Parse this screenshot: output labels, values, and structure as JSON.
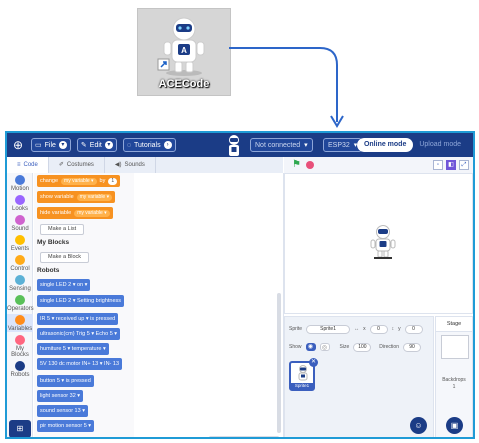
{
  "desktop": {
    "shortcut_label": "ACECode",
    "shortcut_icon": "acecode-robot-icon"
  },
  "menubar": {
    "file_label": "File",
    "edit_label": "Edit",
    "tutorials_label": "Tutorials",
    "connection_status": "Not connected",
    "board": "ESP32",
    "online_mode": "Online mode",
    "upload_mode": "Upload mode"
  },
  "tabs": {
    "code": "Code",
    "costumes": "Costumes",
    "sounds": "Sounds"
  },
  "categories": [
    {
      "label": "Motion",
      "color": "#4a7ad9"
    },
    {
      "label": "Looks",
      "color": "#9966ff"
    },
    {
      "label": "Sound",
      "color": "#cf63cf"
    },
    {
      "label": "Events",
      "color": "#ffbf00"
    },
    {
      "label": "Control",
      "color": "#ffab19"
    },
    {
      "label": "Sensing",
      "color": "#5cb1d6"
    },
    {
      "label": "Operators",
      "color": "#59c059"
    },
    {
      "label": "Variables",
      "color": "#ff8c1a"
    },
    {
      "label": "My Blocks",
      "color": "#ff6680"
    },
    {
      "label": "Robots",
      "color": "#1b3c86"
    }
  ],
  "palette": {
    "change_block": {
      "text": "change",
      "var": "my variable ▾",
      "by": "by",
      "value": "1"
    },
    "show_block": {
      "text": "show variable",
      "var": "my variable ▾"
    },
    "hide_block": {
      "text": "hide variable",
      "var": "my variable ▾"
    },
    "make_list": "Make a List",
    "my_blocks_title": "My Blocks",
    "make_block": "Make a Block",
    "robots_title": "Robots",
    "robot_blocks": [
      "single LED   2 ▾   on ▾",
      "single LED   2 ▾   Setting brightness",
      "IR   5 ▾   received   up ▾   is pressed",
      "ultrasonic(cm) Trig   5 ▾   Echo   5 ▾",
      "humiture   5 ▾   temperature ▾",
      "5V 130 dc motor IN+   13 ▾   IN-   13",
      "button   5 ▾   is pressed",
      "light sensor   32 ▾",
      "sound sensor   13 ▾",
      "pir motion sensor   5 ▾"
    ]
  },
  "script": {
    "zoom_in": "+",
    "zoom_out": "−",
    "zoom_reset": "="
  },
  "sprite_info": {
    "sprite_label": "Sprite",
    "sprite_name": "Sprite1",
    "x_label": "x",
    "x_value": "0",
    "y_label": "y",
    "y_value": "0",
    "show_label": "Show",
    "size_label": "Size",
    "size_value": "100",
    "direction_label": "Direction",
    "direction_value": "90",
    "thumb_name": "Sprite1"
  },
  "stage_panel": {
    "header": "Stage",
    "backdrops_label": "Backdrops",
    "backdrops_count": "1"
  }
}
